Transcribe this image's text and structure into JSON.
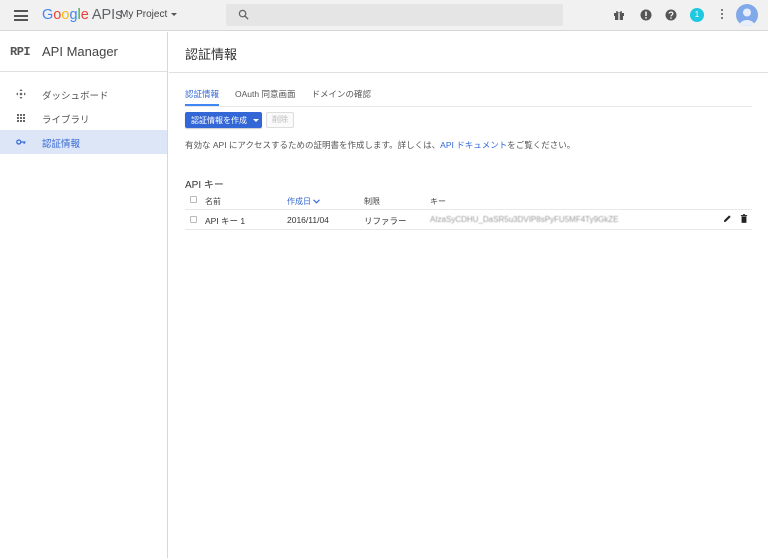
{
  "header": {
    "brand": {
      "letters": [
        "G",
        "o",
        "o",
        "g",
        "l",
        "e"
      ],
      "suffix": "APIs"
    },
    "project": "My Project",
    "notification_count": "1",
    "icons": [
      "menu-icon",
      "search-icon",
      "gift-icon",
      "alert-icon",
      "help-icon",
      "more-vert-icon",
      "avatar"
    ]
  },
  "sidebar": {
    "logo": "RPI",
    "title": "API Manager",
    "items": [
      {
        "label": "ダッシュボード",
        "icon": "dashboard-icon"
      },
      {
        "label": "ライブラリ",
        "icon": "library-icon"
      },
      {
        "label": "認証情報",
        "icon": "key-icon",
        "active": true
      }
    ]
  },
  "main": {
    "title": "認証情報",
    "tabs": [
      {
        "label": "認証情報",
        "active": true
      },
      {
        "label": "OAuth 同意画面"
      },
      {
        "label": "ドメインの確認"
      }
    ],
    "create_button": "認証情報を作成",
    "delete_button": "削除",
    "desc_prefix": "有効な API にアクセスするための証明書を作成します。詳しくは、",
    "desc_link": "API ドキュメント",
    "desc_suffix": "をご覧ください。",
    "section_title": "API キー",
    "table": {
      "headers": {
        "name": "名前",
        "created": "作成日",
        "limit": "制限",
        "key": "キー"
      },
      "rows": [
        {
          "name": "API キー 1",
          "created": "2016/11/04",
          "limit": "リファラー",
          "key": "AIzaSyCDHU_DaSR5u3DVIP8sPyFU5MF4Ty9GkZE"
        }
      ]
    }
  },
  "colors": {
    "accent": "#3367d6",
    "notification": "#1ec8e0",
    "active_bg": "#dde6f7"
  }
}
